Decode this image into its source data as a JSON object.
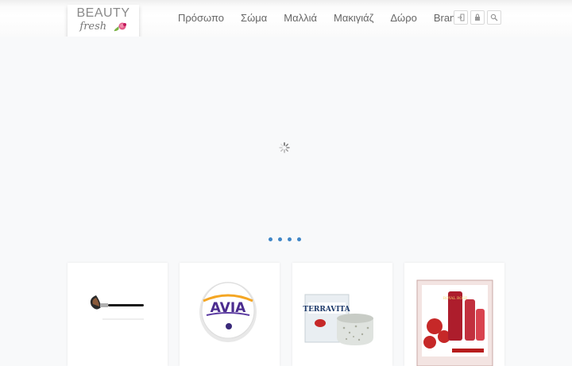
{
  "brand": {
    "line1": "BEAUTY",
    "line2": "fresh",
    "accent_color": "#2b8a8c"
  },
  "nav": {
    "items": [
      {
        "label": "Πρόσωπο"
      },
      {
        "label": "Σώμα"
      },
      {
        "label": "Μαλλιά"
      },
      {
        "label": "Μακιγιάζ"
      },
      {
        "label": "Δώρο"
      },
      {
        "label": "Brands"
      }
    ]
  },
  "header_icons": [
    "login-icon",
    "bag-icon",
    "search-icon"
  ],
  "slider": {
    "loading": true,
    "dots": 4,
    "dot_color": "#3f86c6"
  },
  "products": [
    {
      "kind": "makeup brush"
    },
    {
      "kind": "AVIA cream jar",
      "brand_text": "AVIA"
    },
    {
      "kind": "TERRAVITA scrub jar",
      "brand_text": "TERRAVITA"
    },
    {
      "kind": "rose gift set",
      "brand_text": "ROYAL ROSE"
    }
  ]
}
